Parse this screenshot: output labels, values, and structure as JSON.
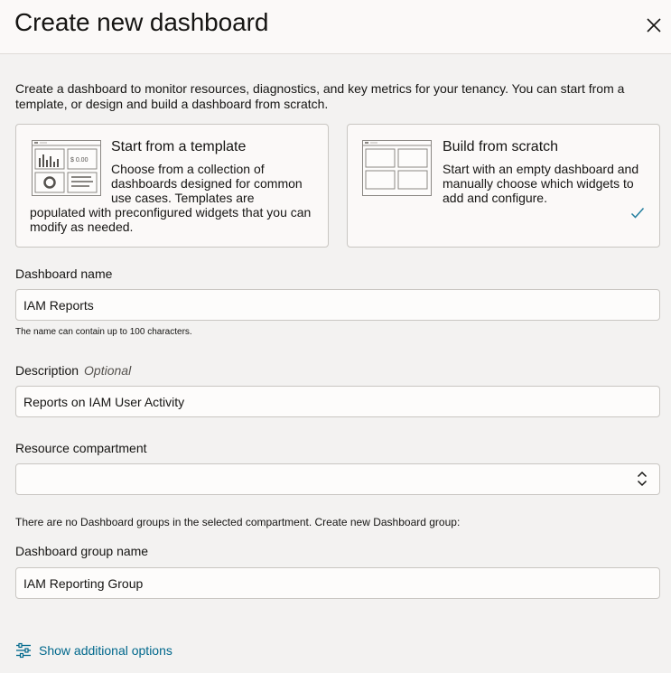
{
  "header": {
    "title": "Create new dashboard",
    "close_icon": "close-icon"
  },
  "intro": "Create a dashboard to monitor resources, diagnostics, and key metrics for your tenancy. You can start from a template, or design and build a dashboard from scratch.",
  "cards": {
    "template": {
      "title": "Start from a template",
      "desc_a": "Choose from a collection of dashboards designed for common use cases. Templates are",
      "desc_b": "populated with preconfigured widgets that you can modify as needed.",
      "illustration_price": "$ 0.00",
      "icon": "template-illustration-icon"
    },
    "scratch": {
      "title": "Build from scratch",
      "desc_a": "Start with an empty dashboard and manually choose which widgets to add and configure.",
      "icon": "blank-grid-illustration-icon",
      "selected_icon": "check-icon",
      "selected": true
    }
  },
  "form": {
    "name": {
      "label": "Dashboard name",
      "value": "IAM Reports",
      "helper": "The name can contain up to 100 characters."
    },
    "description": {
      "label": "Description",
      "optional": "Optional",
      "value": "Reports on IAM User Activity"
    },
    "compartment": {
      "label": "Resource compartment",
      "value": "",
      "icon": "select-arrows-icon"
    },
    "notice": "There are no Dashboard groups in the selected compartment. Create new Dashboard group:",
    "group_name": {
      "label": "Dashboard group name",
      "value": "IAM Reporting Group"
    }
  },
  "footer": {
    "show_options": "Show additional options",
    "icon": "sliders-icon"
  },
  "colors": {
    "link": "#00688c",
    "check": "#227e9e",
    "border": "#c9c6c2",
    "background": "#f3f2f1"
  }
}
